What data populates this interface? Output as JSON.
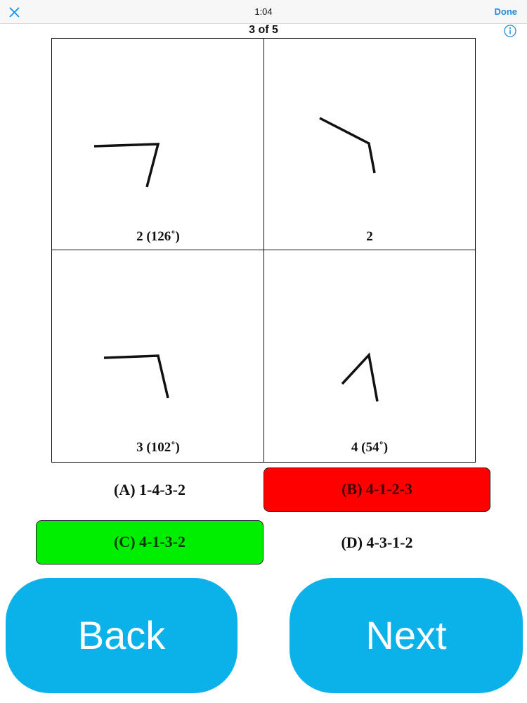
{
  "topbar": {
    "time": "1:04",
    "done_label": "Done",
    "close_icon": "close-icon",
    "accent": "#1a8fe3"
  },
  "question": {
    "counter": "3 of 5",
    "info_icon": "info-icon"
  },
  "panels": [
    {
      "caption": "2 (126˚)"
    },
    {
      "caption": "2"
    },
    {
      "caption": "3 (102˚)"
    },
    {
      "caption": "4 (54˚)"
    }
  ],
  "options": [
    {
      "label": "(A)  1-4-3-2",
      "state": "none"
    },
    {
      "label": "(B)  4-1-2-3",
      "state": "wrong",
      "color": "#ff0000"
    },
    {
      "label": "(C)  4-1-3-2",
      "state": "correct",
      "color": "#00ee00"
    },
    {
      "label": "(D)  4-3-1-2",
      "state": "none"
    }
  ],
  "nav": {
    "back_label": "Back",
    "next_label": "Next",
    "color": "#0bb2ea"
  }
}
